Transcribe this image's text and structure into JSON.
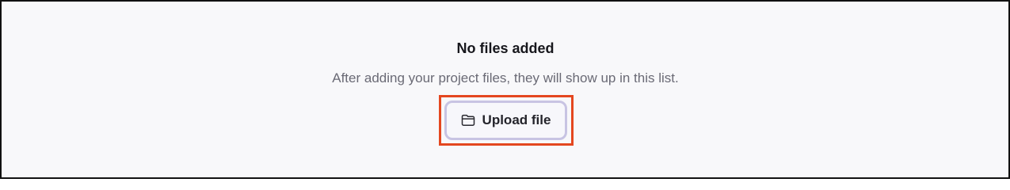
{
  "empty_state": {
    "title": "No files added",
    "subtitle": "After adding your project files, they will show up in this list."
  },
  "upload_button": {
    "label": "Upload file",
    "icon": "folder-icon"
  },
  "colors": {
    "highlight": "#e4471f",
    "button_border": "#c8c4e3",
    "panel_background": "#f8f8fa",
    "title_text": "#17171c",
    "subtitle_text": "#6a6a75"
  }
}
